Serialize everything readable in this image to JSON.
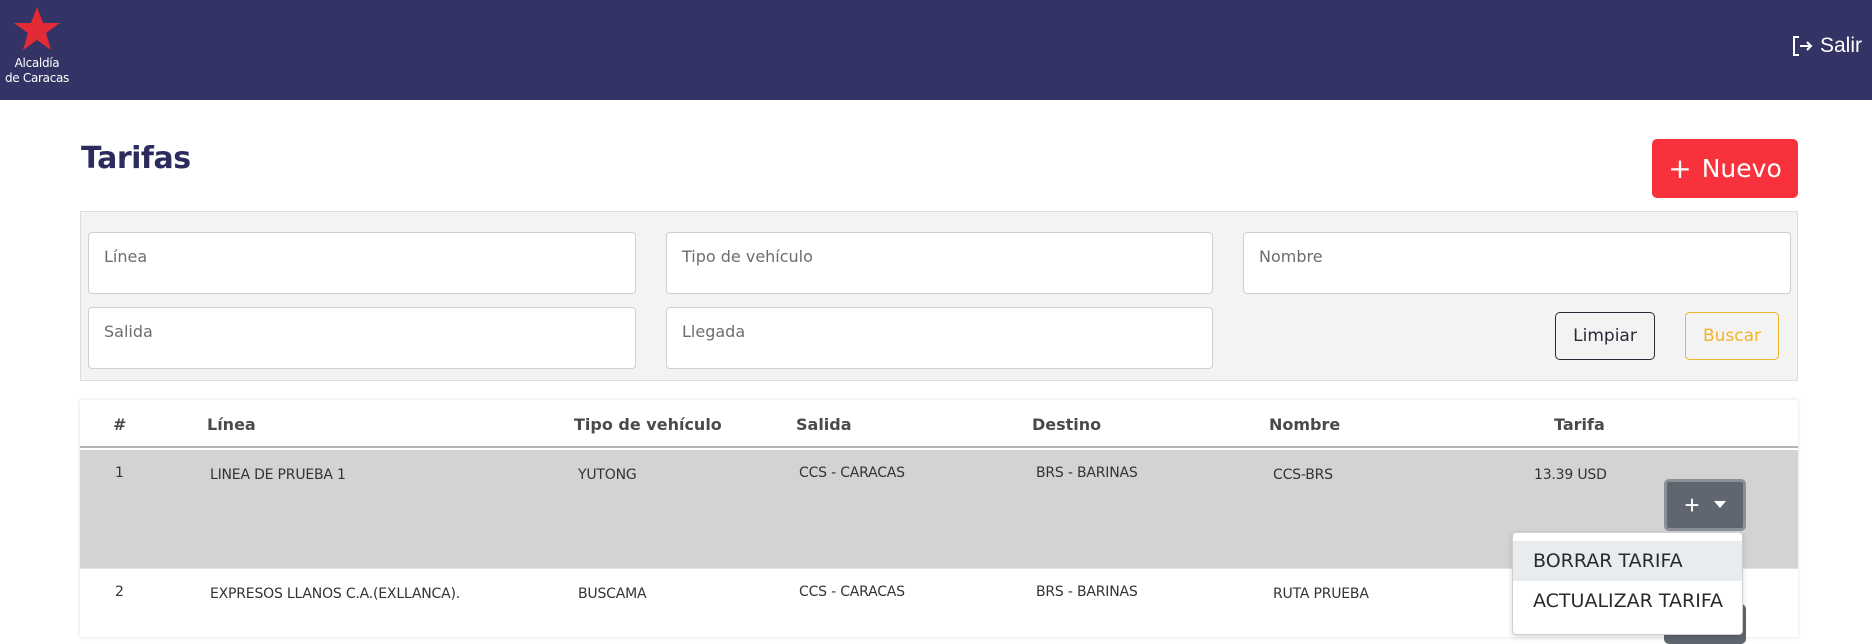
{
  "header": {
    "logo_line1": "Alcaldía",
    "logo_line2": "de Caracas",
    "logout_label": "Salir"
  },
  "page": {
    "title": "Tarifas",
    "new_button": "Nuevo"
  },
  "filters": {
    "linea": "Línea",
    "tipo_vehiculo": "Tipo de vehículo",
    "nombre": "Nombre",
    "salida": "Salida",
    "llegada": "Llegada",
    "clear_button": "Limpiar",
    "search_button": "Buscar"
  },
  "table": {
    "columns": [
      "#",
      "Línea",
      "Tipo de vehículo",
      "Salida",
      "Destino",
      "Nombre",
      "Tarifa"
    ],
    "rows": [
      {
        "num": "1",
        "linea": "LINEA DE PRUEBA 1",
        "tipo": "YUTONG",
        "salida": "CCS - CARACAS",
        "destino": "BRS - BARINAS",
        "nombre": "CCS-BRS",
        "tarifa": "13.39 USD"
      },
      {
        "num": "2",
        "linea": "EXPRESOS LLANOS C.A.(EXLLANCA).",
        "tipo": "BUSCAMA",
        "salida": "CCS - CARACAS",
        "destino": "BRS - BARINAS",
        "nombre": "RUTA PRUEBA",
        "tarifa": ""
      }
    ]
  },
  "dropdown": {
    "items": [
      "BORRAR TARIFA",
      "ACTUALIZAR TARIFA"
    ]
  },
  "colors": {
    "header_bg": "#333366",
    "accent_red": "#f7323c",
    "search_yellow": "#f0b429"
  }
}
